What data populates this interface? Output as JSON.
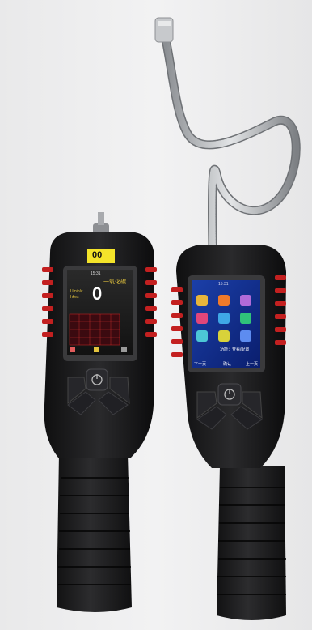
{
  "left_device": {
    "sensor_tag": "00",
    "screen": {
      "status_time": "15:31",
      "gas_name": "一氧化碳",
      "reading": "0",
      "unit_line1": "Umin/c",
      "unit_line2": "hkes"
    }
  },
  "right_device": {
    "screen": {
      "status_time": "15:31",
      "menu_hint": "功能：查看/配置",
      "softkey_left": "下一页",
      "softkey_center": "确认",
      "softkey_right": "上一页"
    }
  },
  "colors": {
    "body": "#1c1c1e",
    "red_vent": "#c32020",
    "screen_border": "#3a3a3c",
    "tag": "#f4e42a",
    "hose": "#b9bcc0"
  }
}
